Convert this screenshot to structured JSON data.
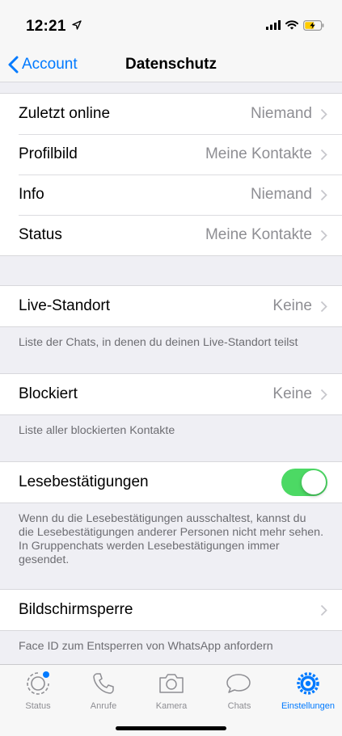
{
  "status_bar": {
    "time": "12:21"
  },
  "nav": {
    "back_label": "Account",
    "title": "Datenschutz"
  },
  "privacy": [
    {
      "label": "Zuletzt online",
      "value": "Niemand"
    },
    {
      "label": "Profilbild",
      "value": "Meine Kontakte"
    },
    {
      "label": "Info",
      "value": "Niemand"
    },
    {
      "label": "Status",
      "value": "Meine Kontakte"
    }
  ],
  "live_location": {
    "label": "Live-Standort",
    "value": "Keine",
    "footer": "Liste der Chats, in denen du deinen Live-Standort teilst"
  },
  "blocked": {
    "label": "Blockiert",
    "value": "Keine",
    "footer": "Liste aller blockierten Kontakte"
  },
  "read_receipts": {
    "label": "Lesebestätigungen",
    "enabled": true,
    "footer": "Wenn du die Lesebestätigungen ausschaltest, kannst du die Lesebestätigungen anderer Personen nicht mehr sehen. In Gruppenchats werden Lesebestätigungen immer gesendet."
  },
  "screen_lock": {
    "label": "Bildschirmsperre",
    "footer": "Face ID zum Entsperren von WhatsApp anfordern"
  },
  "tab_bar": {
    "tabs": [
      {
        "label": "Status",
        "icon": "status-icon"
      },
      {
        "label": "Anrufe",
        "icon": "phone-icon"
      },
      {
        "label": "Kamera",
        "icon": "camera-icon"
      },
      {
        "label": "Chats",
        "icon": "chats-icon"
      },
      {
        "label": "Einstellungen",
        "icon": "settings-gear-icon",
        "active": true
      }
    ]
  },
  "colors": {
    "accent": "#007aff",
    "toggle_on": "#4cd964",
    "background": "#efeff4"
  }
}
